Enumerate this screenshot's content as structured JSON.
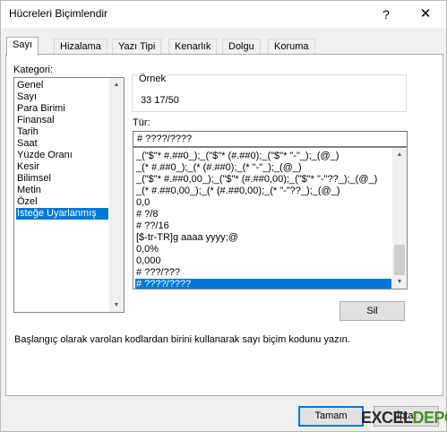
{
  "window": {
    "title": "Hücreleri Biçimlendir",
    "help_glyph": "?",
    "close_glyph": "✕"
  },
  "tabs": [
    {
      "label": "Sayı",
      "active": true
    },
    {
      "label": "Hizalama"
    },
    {
      "label": "Yazı Tipi"
    },
    {
      "label": "Kenarlık"
    },
    {
      "label": "Dolgu"
    },
    {
      "label": "Koruma"
    }
  ],
  "category": {
    "label": "Kategori:",
    "items": [
      "Genel",
      "Sayı",
      "Para Birimi",
      "Finansal",
      "Tarih",
      "Saat",
      "Yüzde Oranı",
      "Kesir",
      "Bilimsel",
      "Metin",
      "Özel",
      "İsteğe Uyarlanmış"
    ],
    "selected": "İsteğe Uyarlanmış"
  },
  "sample": {
    "label": "Örnek",
    "value": "33   17/50"
  },
  "type": {
    "label": "Tür:",
    "value": "# ????/????",
    "list": [
      "_(\"$\"* #.##0_);_(\"$\"* (#.##0);_(\"$\"* \"-\"_);_(@_)",
      "_(* #.##0_);_(* (#.##0);_(* \"-\"_);_(@_)",
      "_(\"$\"* #.##0,00_);_(\"$\"* (#.##0,00);_(\"$\"* \"-\"??_);_(@_)",
      "_(* #.##0,00_);_(* (#.##0,00);_(* \"-\"??_);_(@_)",
      "0,0",
      "# ?/8",
      "# ??/16",
      "[$-tr-TR]g aaaa yyyy;@",
      "0,0%",
      "0,000",
      "# ???/???",
      "# ????/????"
    ],
    "selected": "# ????/????"
  },
  "buttons": {
    "delete": "Sil",
    "ok": "Tamam",
    "cancel": "İptal"
  },
  "hint": "Başlangıç olarak varolan kodlardan birini kullanarak sayı biçim kodunu yazın.",
  "watermark": {
    "part1": "EXCEL",
    "part2": "DEPO"
  }
}
